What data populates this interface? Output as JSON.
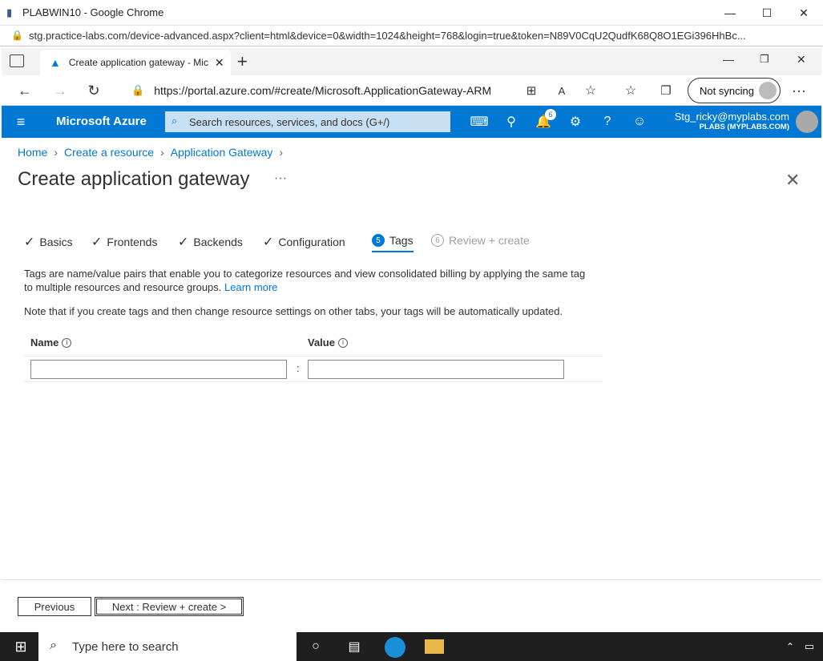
{
  "outer_window": {
    "title": "PLABWIN10 - Google Chrome",
    "url": "stg.practice-labs.com/device-advanced.aspx?client=html&device=0&width=1024&height=768&login=true&token=N89V0CqU2QudfK68Q8O1EGi396HhBc..."
  },
  "edge": {
    "tab_title": "Create application gateway - Mic",
    "address": "https://portal.azure.com/#create/Microsoft.ApplicationGateway-ARM",
    "sync_label": "Not syncing"
  },
  "azure_header": {
    "brand": "Microsoft Azure",
    "search_placeholder": "Search resources, services, and docs (G+/)",
    "notification_count": "6",
    "account_name": "Stg_ricky@myplabs.com",
    "account_org": "PLABS (MYPLABS.COM)"
  },
  "breadcrumb": [
    "Home",
    "Create a resource",
    "Application Gateway"
  ],
  "page": {
    "title": "Create application gateway",
    "ellipsis": "···",
    "close": "✕"
  },
  "wizard_tabs": [
    {
      "label": "Basics",
      "state": "done"
    },
    {
      "label": "Frontends",
      "state": "done"
    },
    {
      "label": "Backends",
      "state": "done"
    },
    {
      "label": "Configuration",
      "state": "done"
    },
    {
      "label": "Tags",
      "state": "active",
      "step": "5"
    },
    {
      "label": "Review + create",
      "state": "disabled",
      "step": "6"
    }
  ],
  "tags": {
    "intro_1": "Tags are name/value pairs that enable you to categorize resources and view consolidated billing by applying the same tag to multiple resources and resource groups.",
    "learn_more": "Learn more",
    "note": "Note that if you create tags and then change resource settings on other tabs, your tags will be automatically updated.",
    "name_header": "Name",
    "value_header": "Value",
    "separator": ":",
    "name_value": "",
    "value_value": ""
  },
  "footer": {
    "previous": "Previous",
    "next": "Next : Review + create >"
  },
  "taskbar": {
    "search_placeholder": "Type here to search"
  }
}
